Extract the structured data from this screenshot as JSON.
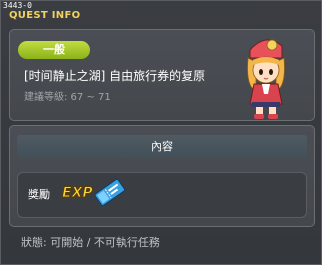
{
  "window": {
    "quest_id": "3443-0",
    "title": "QUEST INFO"
  },
  "quest": {
    "category": "一般",
    "name": "[时间静止之湖] 自由旅行券的复原",
    "level_requirement": "建議等級: 67 ~ 71"
  },
  "content": {
    "header": "內容",
    "reward_label": "獎勵",
    "reward_exp_text": "EXP",
    "reward_item_icon": "free-travel-ticket-icon"
  },
  "status": "狀態: 可開始 / 不可執行任務",
  "colors": {
    "title": "#f2d160",
    "badge": "#a6c72c",
    "panel": "#474b50"
  }
}
